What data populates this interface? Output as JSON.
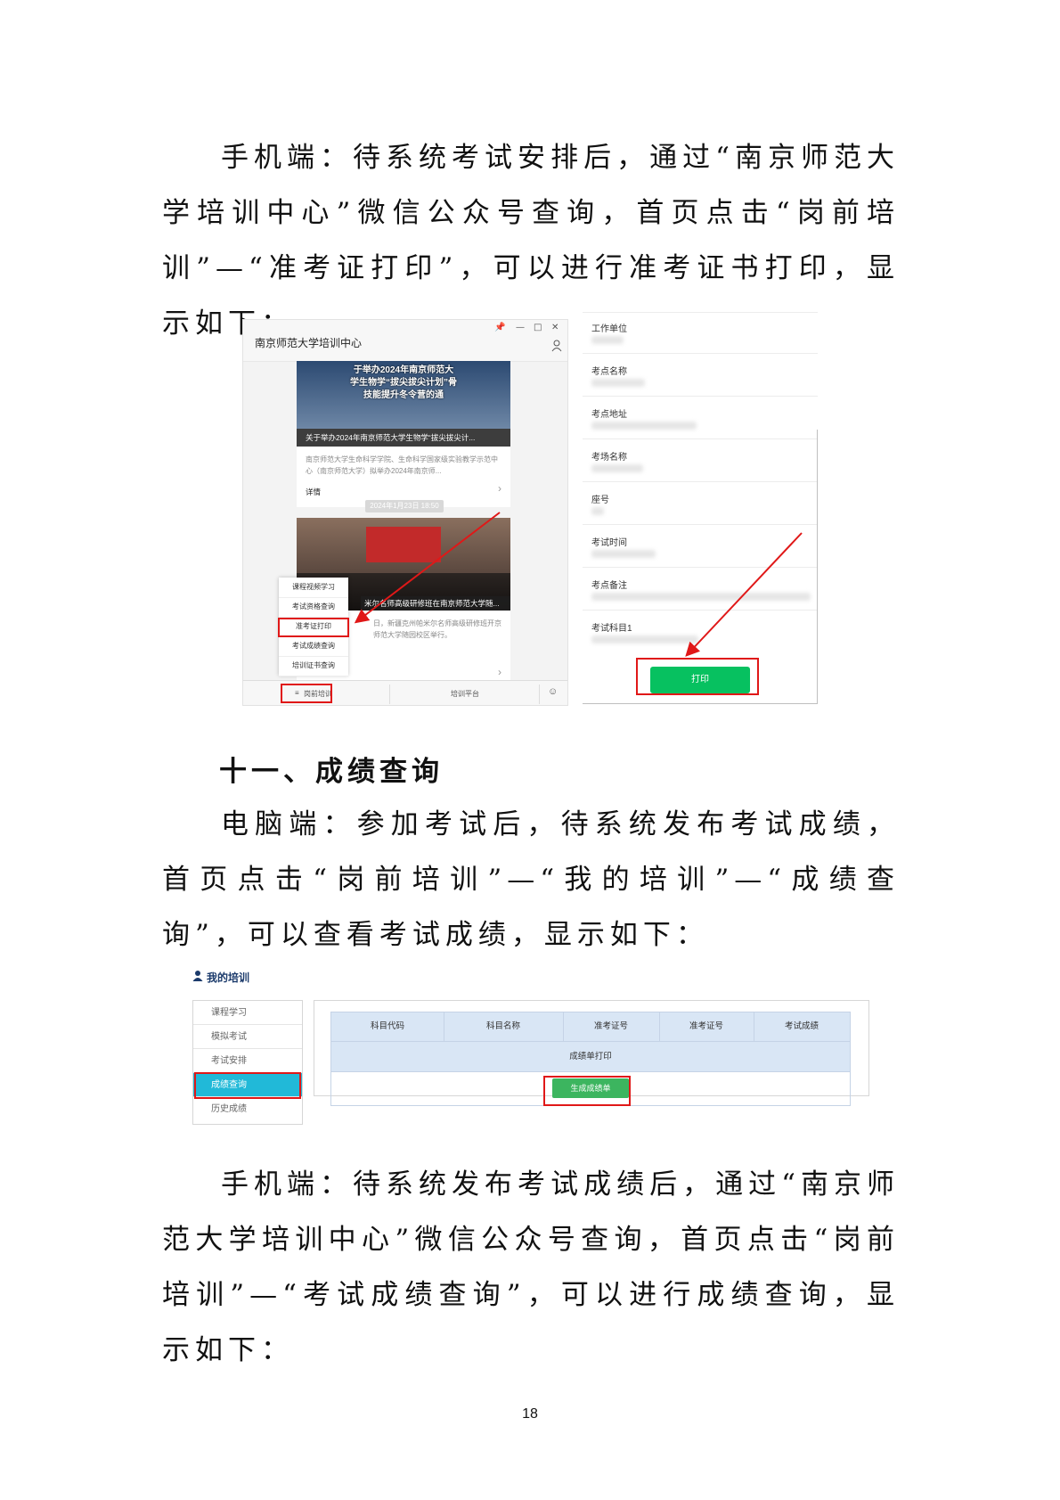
{
  "paragraph1": "手机端：待系统考试安排后，通过“南京师范大学培训中心”微信公众号查询，首页点击“岗前培训”—“准考证打印”，可以进行准考证书打印，显示如下：",
  "heading": "十一、成绩查询",
  "paragraph2": "电脑端：参加考试后，待系统发布考试成绩，首页点击“岗前培训”—“我的培训”—“成绩查询”，可以查看考试成绩，显示如下：",
  "paragraph3": "手机端：待系统发布考试成绩后，通过“南京师范大学培训中心”微信公众号查询，首页点击“岗前培训”—“考试成绩查询”，可以进行成绩查询，显示如下：",
  "page_number": "18",
  "phone1": {
    "title": "南京师范大学培训中心",
    "banner_text": "于举办2024年南京师范大学生物学“拔尖拔尖计划”骨技能提升冬令营的通",
    "card1_caption": "关于举办2024年南京师范大学生物学“拔尖拔尖计...",
    "card1_desc": "南京师范大学生命科学学院、生命科学国家级实验教学示范中心（南京师范大学）拟举办2024年南京师...",
    "card1_detail": "详情",
    "date": "2024年1月23日 18:50",
    "card2_caption": "米尔名师高级研修班在南京师范大学随...",
    "card2_desc": "日，新疆克州帕米尔名师高级研修班开京师范大学随园校区举行。",
    "menu": [
      "课程视频学习",
      "考试资格查询",
      "准考证打印",
      "考试成绩查询",
      "培训证书查询"
    ],
    "bottom_left": "岗前培训",
    "bottom_mid": "培训平台"
  },
  "phone2": {
    "fields": [
      "工作单位",
      "考点名称",
      "考点地址",
      "考场名称",
      "座号",
      "考试时间",
      "考点备注",
      "考试科目1"
    ],
    "print_label": "打印"
  },
  "pc": {
    "title": "我的培训",
    "sidebar": [
      "课程学习",
      "模拟考试",
      "考试安排",
      "成绩查询",
      "历史成绩"
    ],
    "columns": [
      "科目代码",
      "科目名称",
      "准考证号",
      "准考证号",
      "考试成绩"
    ],
    "subheader": "成绩单打印",
    "generate_label": "生成成绩单"
  },
  "colors": {
    "accent_red": "#e01818",
    "wechat_green": "#07c160",
    "active_cyan": "#21b9d8"
  }
}
